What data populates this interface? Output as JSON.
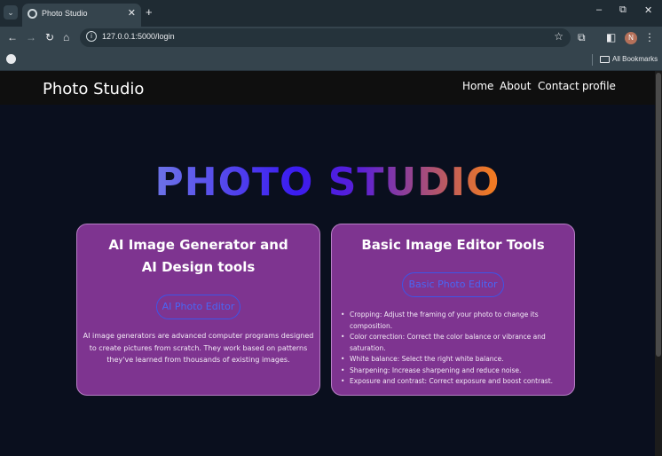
{
  "browser": {
    "tab_title": "Photo Studio",
    "tab_close": "✕",
    "new_tab": "+",
    "url": "127.0.0.1:5000/login",
    "bookmarks_label": "All Bookmarks",
    "avatar_initial": "N",
    "controls": {
      "minimize": "–",
      "restore": "⧉",
      "close": "✕"
    },
    "icons": [
      "back-icon",
      "forward-icon",
      "reload-icon",
      "home-icon",
      "site-info-icon",
      "bookmark-star-icon",
      "extensions-icon",
      "sidebar-icon",
      "menu-icon"
    ]
  },
  "site": {
    "brand": "Photo Studio",
    "nav": [
      "Home",
      "About",
      "Contact",
      "profile"
    ]
  },
  "hero": {
    "title": "PHOTO STUDIO"
  },
  "cards": [
    {
      "title_line1": "AI Image Generator and",
      "title_line2": "AI Design tools",
      "button": "AI Photo Editor",
      "description_lines": [
        "AI image generators are advanced computer programs designed",
        "to create pictures from scratch. They work based on patterns",
        "they've learned from thousands of existing images."
      ]
    },
    {
      "title": "Basic Image Editor Tools",
      "button": "Basic Photo Editor",
      "features": [
        "Cropping: Adjust the framing of your photo to change its composition.",
        "Color correction: Correct the color balance or vibrance and saturation.",
        "White balance: Select the right white balance.",
        "Sharpening: Increase sharpening and reduce noise.",
        "Exposure and contrast: Correct exposure and boost contrast."
      ]
    }
  ],
  "colors": {
    "page_bg": "#0a0f1e",
    "nav_bg": "#0f0f0f",
    "card_bg": "#7e3490",
    "button_border": "#3d55e8"
  }
}
